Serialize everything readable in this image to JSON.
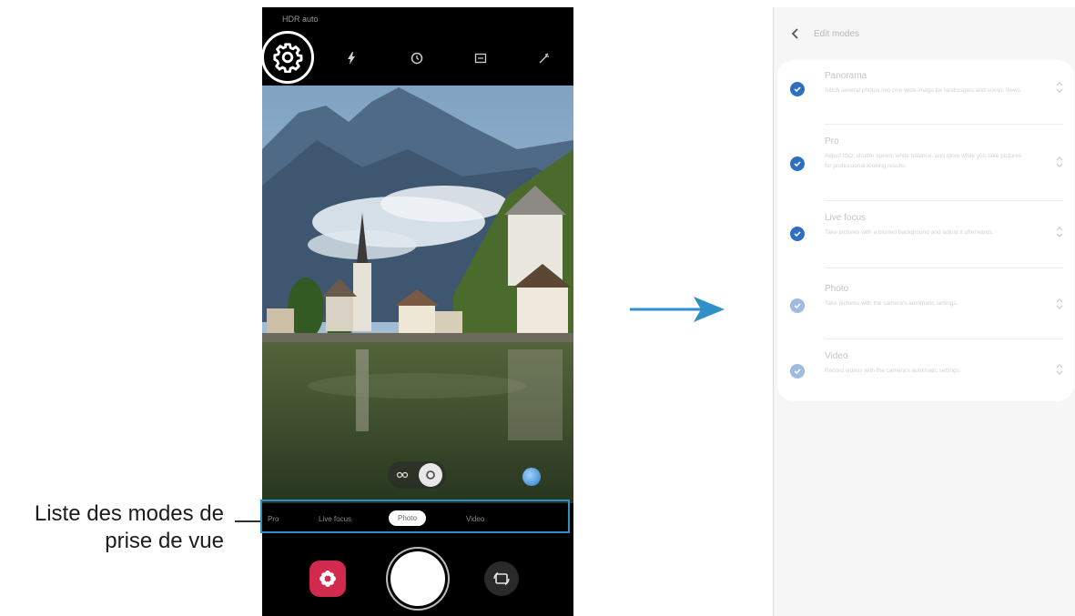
{
  "left_phone": {
    "status_text": "HDR auto",
    "top_icons": [
      "gear-icon",
      "flash-icon",
      "timer-icon",
      "aspect-ratio-icon",
      "filter-icon"
    ],
    "modes": [
      "Pro",
      "Live focus",
      "Photo",
      "Video"
    ],
    "selected_mode": "Photo"
  },
  "callout": {
    "line1": "Liste des modes de",
    "line2": "prise de vue"
  },
  "right_phone": {
    "back_icon": "chevron-left-icon",
    "title": "Edit modes",
    "mode_list": [
      {
        "name": "Panorama",
        "desc": "Stitch several photos into one wide image for landscapes and scenic views.",
        "checked": true,
        "status_color": "#2f6fc2"
      },
      {
        "name": "Pro",
        "desc": "Adjust ISO, shutter speed, white balance, and more while you take pictures for professional-looking results.",
        "checked": true,
        "status_color": "#2f6fc2"
      },
      {
        "name": "Live focus",
        "desc": "Take pictures with a blurred background and adjust it afterwards.",
        "checked": true,
        "status_color": "#2f6fc2"
      },
      {
        "name": "Photo",
        "desc": "Take pictures with the camera's automatic settings.",
        "checked": true,
        "status_color": "#9fbadf"
      },
      {
        "name": "Video",
        "desc": "Record videos with the camera's automatic settings.",
        "checked": true,
        "status_color": "#9fbadf"
      }
    ]
  },
  "colors": {
    "accent_blue": "#2f8fc6",
    "bixby_red": "#d22a4f",
    "check_blue": "#2f6fc2"
  }
}
